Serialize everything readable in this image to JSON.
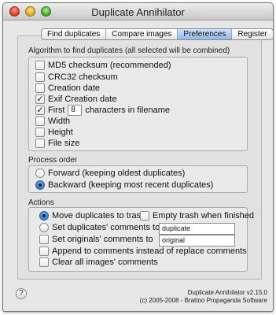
{
  "window": {
    "title": "Duplicate Annihilator"
  },
  "tabs": [
    {
      "label": "Find duplicates"
    },
    {
      "label": "Compare images"
    },
    {
      "label": "Preferences",
      "active": true
    },
    {
      "label": "Register"
    }
  ],
  "algorithm": {
    "label": "Algorithm to find duplicates (all selected will be combined)",
    "md5": {
      "label": "MD5 checksum (recommended)",
      "checked": false
    },
    "crc32": {
      "label": "CRC32 checksum",
      "checked": false
    },
    "creation_date": {
      "label": "Creation date",
      "checked": false
    },
    "exif_creation_date": {
      "label": "Exif Creation date",
      "checked": true
    },
    "first_chars": {
      "prefix": "First",
      "value": "8",
      "suffix": "characters in filename",
      "checked": true
    },
    "width": {
      "label": "Width",
      "checked": false
    },
    "height": {
      "label": "Height",
      "checked": false
    },
    "file_size": {
      "label": "File size",
      "checked": false
    }
  },
  "process_order": {
    "label": "Process order",
    "forward": {
      "label": "Forward (keeping oldest duplicates)",
      "selected": false
    },
    "backward": {
      "label": "Backward (keeping most recent duplicates)",
      "selected": true
    }
  },
  "actions": {
    "label": "Actions",
    "move_to_trash": {
      "label": "Move duplicates to trash",
      "selected": true
    },
    "empty_trash": {
      "label": "Empty trash when finished",
      "checked": false
    },
    "set_dup_comments": {
      "label": "Set duplicates' comments to",
      "value": "duplicate",
      "selected": false
    },
    "set_orig_comments": {
      "label": "Set originals' comments to",
      "value": "original",
      "checked": false
    },
    "append_comments": {
      "label": "Append to comments instead of replace comments",
      "checked": false
    },
    "clear_comments": {
      "label": "Clear all images' comments",
      "checked": false
    }
  },
  "footer": {
    "version": "Duplicate Annihilator v2.15.0",
    "copyright": "(c) 2005-2008 - Brattoo Propaganda Software",
    "help_label": "?"
  },
  "colors": {
    "accent": "#2f74d0",
    "active_tab": "#8fb8ea"
  }
}
